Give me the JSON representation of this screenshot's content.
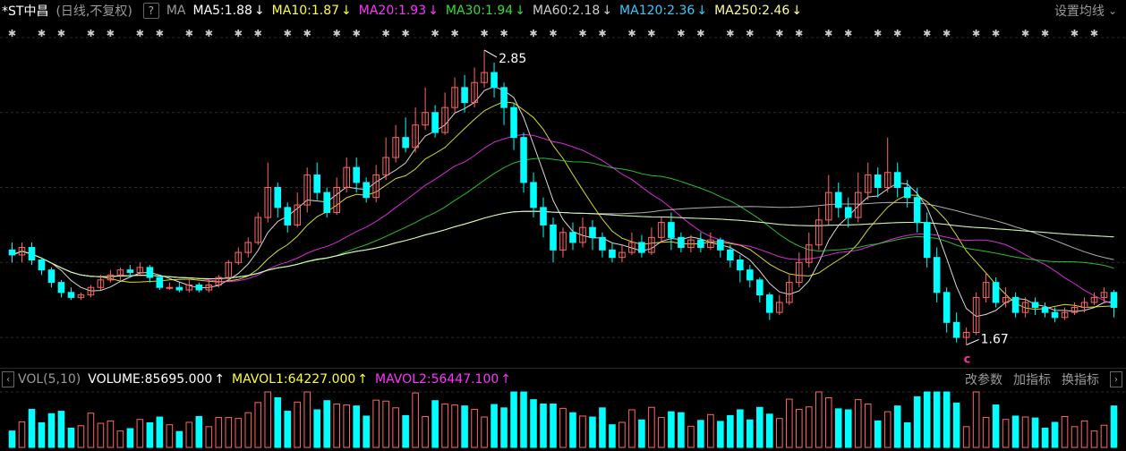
{
  "header": {
    "stock_name": "*ST中昌",
    "mode": "(日线,不复权)",
    "help_icon": "question-mark-icon",
    "ma_label": "MA",
    "ma_items": [
      {
        "text": "MA5:1.88",
        "color": "#ffffff",
        "arrow": "↓"
      },
      {
        "text": "MA10:1.87",
        "color": "#ffff33",
        "arrow": "↓"
      },
      {
        "text": "MA20:1.93",
        "color": "#ff33ff",
        "arrow": "↓"
      },
      {
        "text": "MA30:1.94",
        "color": "#33dd33",
        "arrow": "↓"
      },
      {
        "text": "MA60:2.18",
        "color": "#cccccc",
        "arrow": "↓"
      },
      {
        "text": "MA120:2.36",
        "color": "#33ccff",
        "arrow": "↓"
      },
      {
        "text": "MA250:2.46",
        "color": "#ffff99",
        "arrow": "↓"
      }
    ],
    "settings_label": "设置均线",
    "settings_arrow": "chevron-down-icon"
  },
  "price_chart": {
    "high_label": "2.85",
    "low_label": "1.67",
    "marker_label": "c",
    "up_color": "#ff6666",
    "down_color": "#00ffff"
  },
  "volume_header": {
    "collapse_icon": "left-arrow-icon",
    "vol_label": "VOL(5,10)",
    "items": [
      {
        "text": "VOLUME:85695.000",
        "color": "#ffffff",
        "arrow": "↑"
      },
      {
        "text": "MAVOL1:64227.000",
        "color": "#ffff33",
        "arrow": "↑"
      },
      {
        "text": "MAVOL2:56447.100",
        "color": "#ff33ff",
        "arrow": "↑"
      }
    ],
    "btn_change_params": "改参数",
    "btn_add_indicator": "加指标",
    "btn_switch_indicator": "换指标",
    "expand_icon": "right-arrow-icon"
  },
  "chart_data": {
    "type": "candlestick",
    "title": "*ST中昌",
    "ylim": [
      1.6,
      2.95
    ],
    "candles": [
      [
        2.05,
        2.03,
        2.08,
        2.0
      ],
      [
        2.03,
        2.06,
        2.08,
        2.0
      ],
      [
        2.06,
        2.01,
        2.08,
        1.99
      ],
      [
        2.01,
        1.97,
        2.02,
        1.95
      ],
      [
        1.97,
        1.92,
        1.98,
        1.9
      ],
      [
        1.92,
        1.88,
        1.93,
        1.86
      ],
      [
        1.88,
        1.86,
        1.9,
        1.85
      ],
      [
        1.86,
        1.87,
        1.88,
        1.85
      ],
      [
        1.87,
        1.9,
        1.91,
        1.86
      ],
      [
        1.9,
        1.93,
        1.95,
        1.89
      ],
      [
        1.93,
        1.95,
        1.97,
        1.92
      ],
      [
        1.95,
        1.97,
        1.98,
        1.93
      ],
      [
        1.97,
        1.96,
        1.99,
        1.94
      ],
      [
        1.96,
        1.98,
        2.0,
        1.95
      ],
      [
        1.98,
        1.94,
        1.99,
        1.92
      ],
      [
        1.94,
        1.9,
        1.95,
        1.89
      ],
      [
        1.9,
        1.9,
        1.92,
        1.89
      ],
      [
        1.9,
        1.89,
        1.92,
        1.88
      ],
      [
        1.89,
        1.91,
        1.93,
        1.88
      ],
      [
        1.91,
        1.89,
        1.92,
        1.88
      ],
      [
        1.89,
        1.91,
        1.93,
        1.88
      ],
      [
        1.91,
        1.94,
        1.95,
        1.9
      ],
      [
        1.94,
        2.0,
        2.01,
        1.93
      ],
      [
        2.0,
        2.04,
        2.06,
        1.99
      ],
      [
        2.04,
        2.08,
        2.1,
        2.02
      ],
      [
        2.08,
        2.18,
        2.2,
        2.07
      ],
      [
        2.18,
        2.3,
        2.4,
        2.16
      ],
      [
        2.3,
        2.22,
        2.32,
        2.18
      ],
      [
        2.22,
        2.15,
        2.24,
        2.12
      ],
      [
        2.15,
        2.23,
        2.28,
        2.14
      ],
      [
        2.23,
        2.35,
        2.38,
        2.2
      ],
      [
        2.35,
        2.28,
        2.4,
        2.25
      ],
      [
        2.28,
        2.2,
        2.3,
        2.18
      ],
      [
        2.2,
        2.3,
        2.34,
        2.19
      ],
      [
        2.3,
        2.38,
        2.42,
        2.28
      ],
      [
        2.38,
        2.32,
        2.42,
        2.28
      ],
      [
        2.32,
        2.26,
        2.34,
        2.24
      ],
      [
        2.26,
        2.35,
        2.39,
        2.24
      ],
      [
        2.35,
        2.42,
        2.5,
        2.33
      ],
      [
        2.42,
        2.5,
        2.55,
        2.4
      ],
      [
        2.5,
        2.46,
        2.58,
        2.44
      ],
      [
        2.46,
        2.55,
        2.62,
        2.44
      ],
      [
        2.55,
        2.6,
        2.7,
        2.53
      ],
      [
        2.6,
        2.52,
        2.63,
        2.5
      ],
      [
        2.52,
        2.62,
        2.68,
        2.51
      ],
      [
        2.62,
        2.7,
        2.74,
        2.6
      ],
      [
        2.7,
        2.64,
        2.75,
        2.6
      ],
      [
        2.64,
        2.72,
        2.78,
        2.62
      ],
      [
        2.72,
        2.76,
        2.85,
        2.7
      ],
      [
        2.76,
        2.7,
        2.8,
        2.66
      ],
      [
        2.7,
        2.62,
        2.72,
        2.55
      ],
      [
        2.62,
        2.5,
        2.64,
        2.45
      ],
      [
        2.5,
        2.32,
        2.52,
        2.28
      ],
      [
        2.32,
        2.22,
        2.36,
        2.18
      ],
      [
        2.22,
        2.15,
        2.26,
        2.1
      ],
      [
        2.15,
        2.05,
        2.18,
        2.0
      ],
      [
        2.05,
        2.12,
        2.14,
        2.02
      ],
      [
        2.12,
        2.08,
        2.16,
        2.05
      ],
      [
        2.08,
        2.14,
        2.18,
        2.06
      ],
      [
        2.14,
        2.1,
        2.17,
        2.05
      ],
      [
        2.1,
        2.05,
        2.12,
        2.02
      ],
      [
        2.05,
        2.02,
        2.08,
        2.0
      ],
      [
        2.02,
        2.04,
        2.07,
        2.0
      ],
      [
        2.04,
        2.08,
        2.12,
        2.03
      ],
      [
        2.08,
        2.04,
        2.11,
        2.02
      ],
      [
        2.04,
        2.1,
        2.14,
        2.03
      ],
      [
        2.1,
        2.16,
        2.18,
        2.08
      ],
      [
        2.16,
        2.1,
        2.2,
        2.05
      ],
      [
        2.1,
        2.06,
        2.12,
        2.04
      ],
      [
        2.06,
        2.09,
        2.11,
        2.04
      ],
      [
        2.09,
        2.06,
        2.12,
        2.04
      ],
      [
        2.06,
        2.09,
        2.12,
        2.05
      ],
      [
        2.09,
        2.05,
        2.1,
        2.02
      ],
      [
        2.05,
        2.01,
        2.07,
        1.98
      ],
      [
        2.01,
        1.97,
        2.03,
        1.92
      ],
      [
        1.97,
        1.93,
        1.99,
        1.9
      ],
      [
        1.93,
        1.87,
        1.94,
        1.84
      ],
      [
        1.87,
        1.8,
        1.88,
        1.77
      ],
      [
        1.8,
        1.84,
        1.87,
        1.79
      ],
      [
        1.84,
        1.92,
        1.95,
        1.83
      ],
      [
        1.92,
        2.0,
        2.04,
        1.9
      ],
      [
        2.0,
        2.07,
        2.12,
        1.98
      ],
      [
        2.07,
        2.17,
        2.22,
        2.05
      ],
      [
        2.17,
        2.28,
        2.35,
        2.15
      ],
      [
        2.28,
        2.22,
        2.32,
        2.18
      ],
      [
        2.22,
        2.18,
        2.26,
        2.14
      ],
      [
        2.18,
        2.28,
        2.36,
        2.16
      ],
      [
        2.28,
        2.35,
        2.4,
        2.25
      ],
      [
        2.35,
        2.3,
        2.38,
        2.26
      ],
      [
        2.3,
        2.36,
        2.5,
        2.28
      ],
      [
        2.36,
        2.3,
        2.4,
        2.26
      ],
      [
        2.3,
        2.26,
        2.33,
        2.22
      ],
      [
        2.26,
        2.16,
        2.3,
        2.12
      ],
      [
        2.16,
        2.02,
        2.2,
        1.98
      ],
      [
        2.02,
        1.88,
        2.06,
        1.84
      ],
      [
        1.88,
        1.76,
        1.9,
        1.72
      ],
      [
        1.76,
        1.7,
        1.8,
        1.68
      ],
      [
        1.7,
        1.72,
        1.74,
        1.67
      ],
      [
        1.72,
        1.86,
        1.88,
        1.71
      ],
      [
        1.86,
        1.92,
        1.96,
        1.84
      ],
      [
        1.92,
        1.84,
        1.94,
        1.82
      ],
      [
        1.84,
        1.86,
        1.9,
        1.82
      ],
      [
        1.86,
        1.8,
        1.88,
        1.78
      ],
      [
        1.8,
        1.84,
        1.86,
        1.78
      ],
      [
        1.84,
        1.82,
        1.86,
        1.79
      ],
      [
        1.82,
        1.8,
        1.84,
        1.78
      ],
      [
        1.8,
        1.78,
        1.82,
        1.76
      ],
      [
        1.78,
        1.8,
        1.82,
        1.77
      ],
      [
        1.8,
        1.82,
        1.84,
        1.79
      ],
      [
        1.82,
        1.84,
        1.86,
        1.8
      ],
      [
        1.84,
        1.86,
        1.88,
        1.83
      ],
      [
        1.86,
        1.88,
        1.9,
        1.84
      ],
      [
        1.88,
        1.82,
        1.89,
        1.78
      ]
    ],
    "volume_ylim": [
      0,
      115000
    ]
  }
}
